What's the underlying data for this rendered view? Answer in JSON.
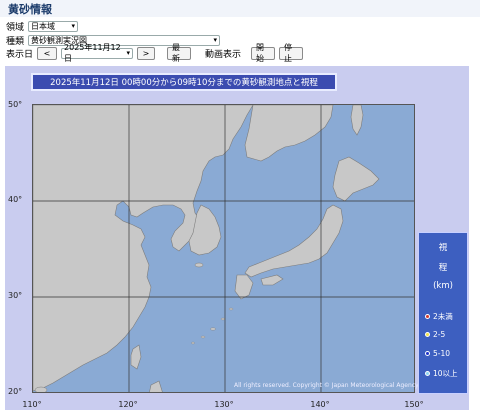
{
  "app": {
    "title": "黄砂情報"
  },
  "controls": {
    "region_label": "領域",
    "region_value": "日本域",
    "type_label": "種類",
    "type_value": "黄砂観測実況図",
    "date_label": "表示日",
    "prev_label": "<",
    "date_value": "2025年11月12日",
    "next_label": ">",
    "latest_label": "最新",
    "animation_label": "動画表示",
    "start_label": "開始",
    "stop_label": "停止"
  },
  "map": {
    "title": "2025年11月12日  00時00分から09時10分までの黄砂観測地点と視程",
    "lat_labels": [
      "50°",
      "40°",
      "30°",
      "20°"
    ],
    "lon_labels": [
      "110°",
      "120°",
      "130°",
      "140°",
      "150°"
    ],
    "copyright": "All rights reserved. Copyright © Japan Meteorological Agency",
    "colors": {
      "sea": "#8aaad4",
      "land": "#c6c6c6",
      "frame": "#c9ccef",
      "banner": "#3b4cb0"
    }
  },
  "legend": {
    "title_1": "視",
    "title_2": "程",
    "unit": "(km)",
    "items": [
      {
        "label": "2未満",
        "color": "#d23a2e"
      },
      {
        "label": "2-5",
        "color": "#f2e34a"
      },
      {
        "label": "5-10",
        "color": "#1f33c9"
      },
      {
        "label": "10以上",
        "color": "#8fd4f0"
      }
    ]
  }
}
